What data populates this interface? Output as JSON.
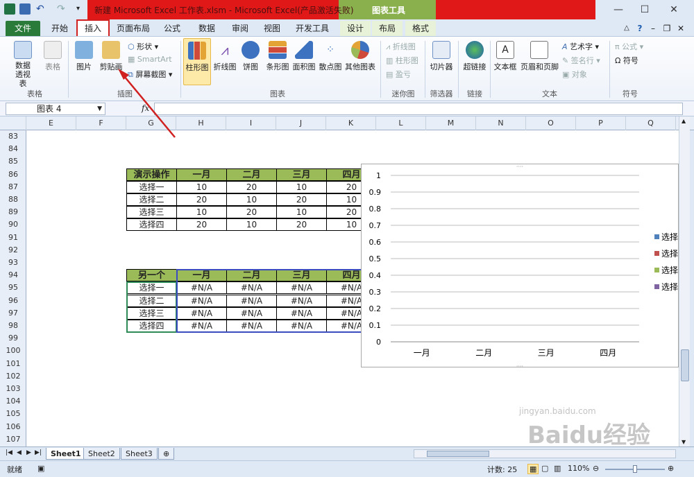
{
  "titlebar": {
    "title": "新建 Microsoft Excel 工作表.xlsm - Microsoft Excel(产品激活失败)",
    "context_tool": "图表工具"
  },
  "tabs": [
    "文件",
    "开始",
    "插入",
    "页面布局",
    "公式",
    "数据",
    "审阅",
    "视图",
    "开发工具",
    "设计",
    "布局",
    "格式"
  ],
  "ribbon": {
    "groups": {
      "tables": "表格",
      "illustrations": "插图",
      "charts": "图表",
      "sparklines": "迷你图",
      "filter": "筛选器",
      "links": "链接",
      "text": "文本",
      "symbols": "符号"
    },
    "buttons": {
      "pivot": "数据透视表",
      "table": "表格",
      "picture": "图片",
      "clipart": "剪贴画",
      "shapes": "形状",
      "smartart": "SmartArt",
      "screenshot": "屏幕截图",
      "column": "柱形图",
      "line": "折线图",
      "pie": "饼图",
      "bar": "条形图",
      "area": "面积图",
      "scatter": "散点图",
      "other": "其他图表",
      "spark_line": "折线图",
      "spark_column": "柱形图",
      "spark_winloss": "盈亏",
      "slicer": "切片器",
      "hyperlink": "超链接",
      "textbox": "文本框",
      "header_footer": "页眉和页脚",
      "wordart": "艺术字",
      "signature": "签名行",
      "object": "对象",
      "equation": "公式",
      "symbol": "符号"
    }
  },
  "formula_bar": {
    "name_box": "图表 4",
    "fx": "fx",
    "value": ""
  },
  "columns": [
    "E",
    "F",
    "G",
    "H",
    "I",
    "J",
    "K",
    "L",
    "M",
    "N",
    "O",
    "P",
    "Q"
  ],
  "rows": [
    "83",
    "84",
    "85",
    "86",
    "87",
    "88",
    "89",
    "90",
    "91",
    "92",
    "93",
    "94",
    "95",
    "96",
    "97",
    "98",
    "99",
    "100",
    "101",
    "102",
    "103",
    "104",
    "105",
    "106",
    "107"
  ],
  "table1": {
    "header": [
      "演示操作",
      "一月",
      "二月",
      "三月",
      "四月"
    ],
    "rows": [
      [
        "选择一",
        "10",
        "20",
        "10",
        "20"
      ],
      [
        "选择二",
        "20",
        "10",
        "20",
        "10"
      ],
      [
        "选择三",
        "10",
        "20",
        "10",
        "20"
      ],
      [
        "选择四",
        "20",
        "10",
        "20",
        "10"
      ]
    ]
  },
  "table2": {
    "header": [
      "另一个",
      "一月",
      "二月",
      "三月",
      "四月"
    ],
    "rows": [
      [
        "选择一",
        "#N/A",
        "#N/A",
        "#N/A",
        "#N/A"
      ],
      [
        "选择二",
        "#N/A",
        "#N/A",
        "#N/A",
        "#N/A"
      ],
      [
        "选择三",
        "#N/A",
        "#N/A",
        "#N/A",
        "#N/A"
      ],
      [
        "选择四",
        "#N/A",
        "#N/A",
        "#N/A",
        "#N/A"
      ]
    ]
  },
  "chart_data": {
    "type": "line",
    "categories": [
      "一月",
      "二月",
      "三月",
      "四月"
    ],
    "ylim": [
      0,
      1
    ],
    "yticks": [
      "0",
      "0.1",
      "0.2",
      "0.3",
      "0.4",
      "0.5",
      "0.6",
      "0.7",
      "0.8",
      "0.9",
      "1"
    ],
    "grid": true,
    "legend": "right",
    "series": [
      {
        "name": "选择",
        "color": "#4f81bd",
        "values": []
      },
      {
        "name": "选择",
        "color": "#c0504d",
        "values": []
      },
      {
        "name": "选择",
        "color": "#9bbb59",
        "values": []
      },
      {
        "name": "选择",
        "color": "#8064a2",
        "values": []
      }
    ]
  },
  "sheets": [
    "Sheet1",
    "Sheet2",
    "Sheet3"
  ],
  "status": {
    "mode": "就绪",
    "count": "计数: 25",
    "zoom": "110%"
  },
  "watermark": {
    "text": "Baidu经验",
    "url": "jingyan.baidu.com"
  },
  "colors": {
    "file_tab": "#2a7a3a",
    "header_fill": "#9bbb59",
    "annotation": "#d02020"
  }
}
